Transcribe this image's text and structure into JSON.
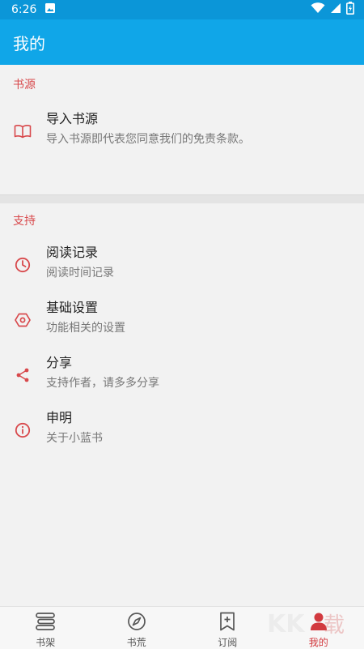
{
  "status_bar": {
    "time": "6:26"
  },
  "app_bar": {
    "title": "我的"
  },
  "sections": [
    {
      "header": "书源",
      "items": [
        {
          "title": "导入书源",
          "subtitle": "导入书源即代表您同意我们的免责条款。",
          "icon": "book-open-icon"
        }
      ]
    },
    {
      "header": "支持",
      "items": [
        {
          "title": "阅读记录",
          "subtitle": "阅读时间记录",
          "icon": "clock-icon"
        },
        {
          "title": "基础设置",
          "subtitle": "功能相关的设置",
          "icon": "settings-hexagon-icon"
        },
        {
          "title": "分享",
          "subtitle": "支持作者，请多多分享",
          "icon": "share-icon"
        },
        {
          "title": "申明",
          "subtitle": "关于小蓝书",
          "icon": "info-icon"
        }
      ]
    }
  ],
  "bottom_nav": [
    {
      "label": "书架",
      "icon": "bookshelf-icon"
    },
    {
      "label": "书荒",
      "icon": "compass-icon"
    },
    {
      "label": "订阅",
      "icon": "bookmark-add-icon"
    },
    {
      "label": "我的",
      "icon": "person-icon",
      "active": true
    }
  ],
  "colors": {
    "primary": "#10a6e8",
    "accent": "#d8494c",
    "active_nav": "#d23a3f"
  }
}
